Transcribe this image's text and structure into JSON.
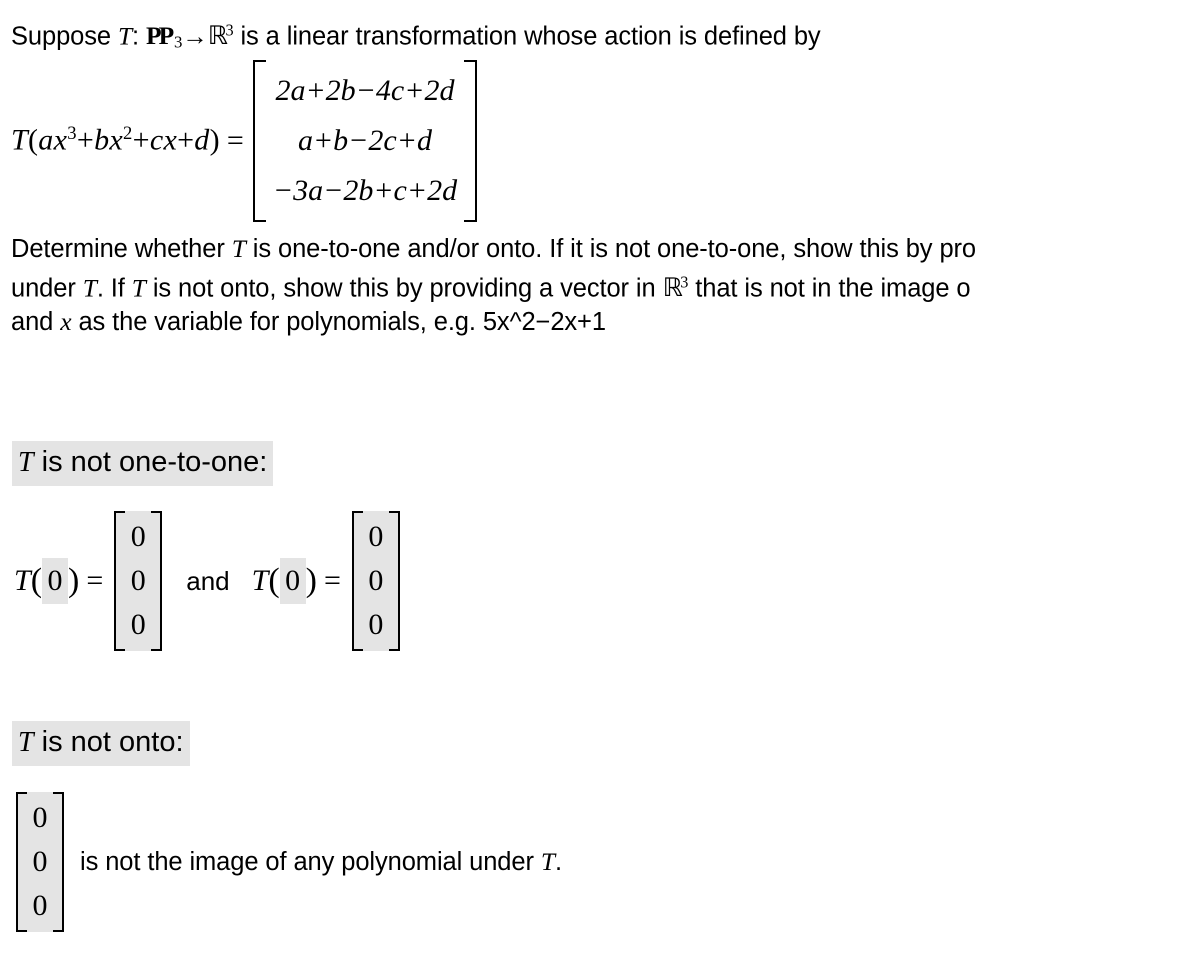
{
  "problem": {
    "statement_prefix": "Suppose ",
    "transform_symbol": "T",
    "colon": ": ",
    "domain_symbol": "P",
    "domain_sub": "3",
    "arrow": "→",
    "codomain_symbol": "ℝ",
    "codomain_sup": "3",
    "statement_suffix": " is a linear transformation whose action is defined by"
  },
  "definition": {
    "lhs_T": "T",
    "lhs_open": "(",
    "lhs_a": "ax",
    "lhs_a_sup": "3",
    "lhs_plus1": "+",
    "lhs_b": "bx",
    "lhs_b_sup": "2",
    "lhs_plus2": "+",
    "lhs_c": "cx",
    "lhs_plus3": "+",
    "lhs_d": "d",
    "lhs_close": ")",
    "equals": "=",
    "rows": [
      "2a+2b−4c+2d",
      "a+b−2c+d",
      "−3a−2b+c+2d"
    ]
  },
  "instructions": {
    "line1": "Determine whether T is one-to-one and/or onto. If it is not one-to-one, show this by pro",
    "line1_a": "Determine whether ",
    "line1_T": "T",
    "line1_b": " is one-to-one and/or onto. If it is not one-to-one, show this by pro",
    "line2_a": "under ",
    "line2_T1": "T",
    "line2_b": ". If ",
    "line2_T2": "T",
    "line2_c": " is not onto, show this by providing a vector in ",
    "line2_R": "ℝ",
    "line2_R_sup": "3",
    "line2_d": " that is not in the image o",
    "line3_a": "and ",
    "line3_x": "x",
    "line3_b": " as the variable for polynomials, e.g. 5x^2−2x+1"
  },
  "answers": {
    "heading_one_to_one_T": "T",
    "heading_one_to_one_text": " is not one-to-one:",
    "heading_onto_T": "T",
    "heading_onto_text": " is not onto:",
    "kernel": {
      "first": {
        "t_symbol": "T",
        "open_paren": "(",
        "input_value": "0",
        "close_paren": ")",
        "equals": "=",
        "vector": [
          "0",
          "0",
          "0"
        ]
      },
      "conjunction": "and",
      "second": {
        "t_symbol": "T",
        "open_paren": "(",
        "input_value": "0",
        "close_paren": ")",
        "equals": "=",
        "vector": [
          "0",
          "0",
          "0"
        ]
      }
    },
    "onto": {
      "vector": [
        "0",
        "0",
        "0"
      ],
      "sentence_a": "is not the image of any polynomial under ",
      "sentence_T": "T",
      "sentence_b": "."
    }
  },
  "colors": {
    "page_background": "#ffffff",
    "text": "#000000",
    "input_highlight": "#e4e4e4"
  }
}
